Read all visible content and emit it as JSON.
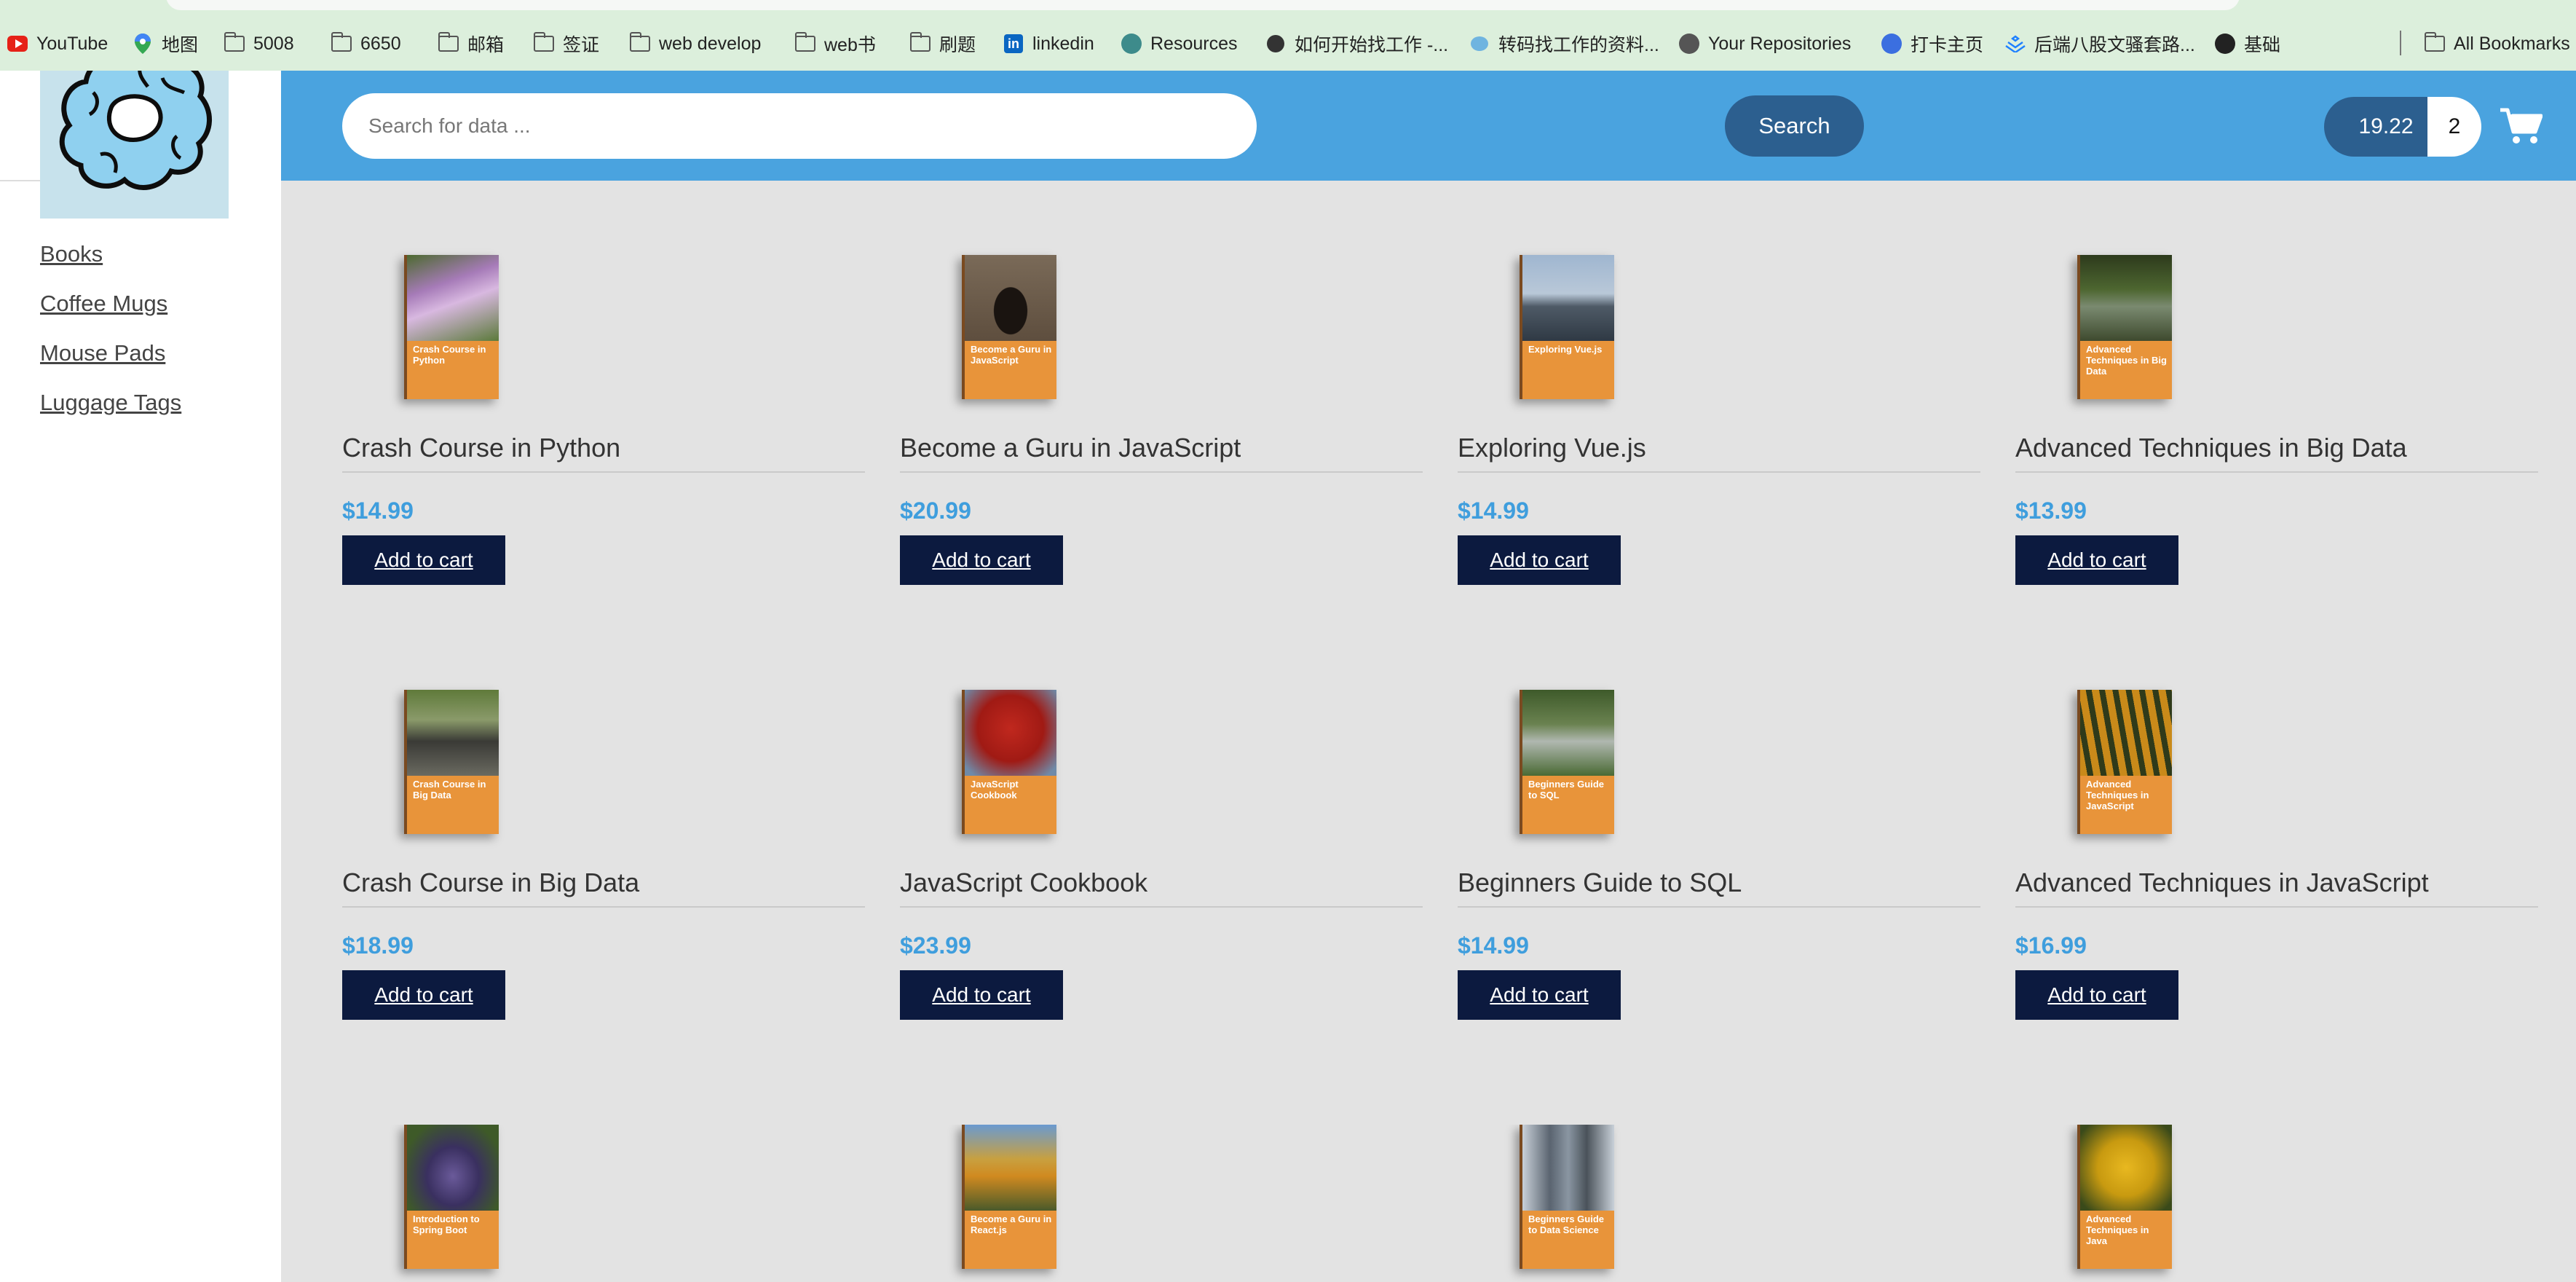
{
  "bookmarks": [
    {
      "label": "YouTube",
      "icon": "youtube-icon"
    },
    {
      "label": "地图",
      "icon": "maps-pin-icon"
    },
    {
      "label": "5008",
      "icon": "folder-icon"
    },
    {
      "label": "6650",
      "icon": "folder-icon"
    },
    {
      "label": "邮箱",
      "icon": "folder-icon"
    },
    {
      "label": "签证",
      "icon": "folder-icon"
    },
    {
      "label": "web develop",
      "icon": "folder-icon"
    },
    {
      "label": "web书",
      "icon": "folder-icon"
    },
    {
      "label": "刷题",
      "icon": "folder-icon"
    },
    {
      "label": "linkedin",
      "icon": "linkedin-icon"
    },
    {
      "label": "Resources",
      "icon": "resources-icon"
    },
    {
      "label": "如何开始找工作 -...",
      "icon": "article-icon"
    },
    {
      "label": "转码找工作的资料...",
      "icon": "bird-icon"
    },
    {
      "label": "Your Repositories",
      "icon": "github-icon"
    },
    {
      "label": "打卡主页",
      "icon": "checkin-icon"
    },
    {
      "label": "后端八股文骚套路...",
      "icon": "juejin-icon"
    },
    {
      "label": "基础",
      "icon": "globe-icon"
    }
  ],
  "all_bookmarks": "All Bookmarks",
  "sidebar": {
    "logo": "scrunchie-logo",
    "nav": [
      "Books",
      "Coffee Mugs",
      "Mouse Pads",
      "Luggage Tags"
    ]
  },
  "header": {
    "search_placeholder": "Search for data ...",
    "search_value": "",
    "search_button": "Search",
    "cart_total": "19.22",
    "cart_count": "2",
    "cart_icon": "shopping-cart-icon"
  },
  "colors": {
    "header_bg": "#4aa3df",
    "button_dark": "#0c1a3f",
    "price": "#3f9edd",
    "cover_band": "#e8943a"
  },
  "products": [
    {
      "title": "Crash Course in Python",
      "price": "$14.99",
      "button": "Add to cart",
      "cover_title": "Crash Course in Python"
    },
    {
      "title": "Become a Guru in JavaScript",
      "price": "$20.99",
      "button": "Add to cart",
      "cover_title": "Become a Guru in JavaScript"
    },
    {
      "title": "Exploring Vue.js",
      "price": "$14.99",
      "button": "Add to cart",
      "cover_title": "Exploring Vue.js"
    },
    {
      "title": "Advanced Techniques in Big Data",
      "price": "$13.99",
      "button": "Add to cart",
      "cover_title": "Advanced Techniques in Big Data"
    },
    {
      "title": "Crash Course in Big Data",
      "price": "$18.99",
      "button": "Add to cart",
      "cover_title": "Crash Course in Big Data"
    },
    {
      "title": "JavaScript Cookbook",
      "price": "$23.99",
      "button": "Add to cart",
      "cover_title": "JavaScript Cookbook"
    },
    {
      "title": "Beginners Guide to SQL",
      "price": "$14.99",
      "button": "Add to cart",
      "cover_title": "Beginners Guide to SQL"
    },
    {
      "title": "Advanced Techniques in JavaScript",
      "price": "$16.99",
      "button": "Add to cart",
      "cover_title": "Advanced Techniques in JavaScript"
    },
    {
      "cover_title": "Introduction to Spring Boot"
    },
    {
      "cover_title": "Become a Guru in React.js"
    },
    {
      "cover_title": "Beginners Guide to Data Science"
    },
    {
      "cover_title": "Advanced Techniques in Java"
    }
  ]
}
